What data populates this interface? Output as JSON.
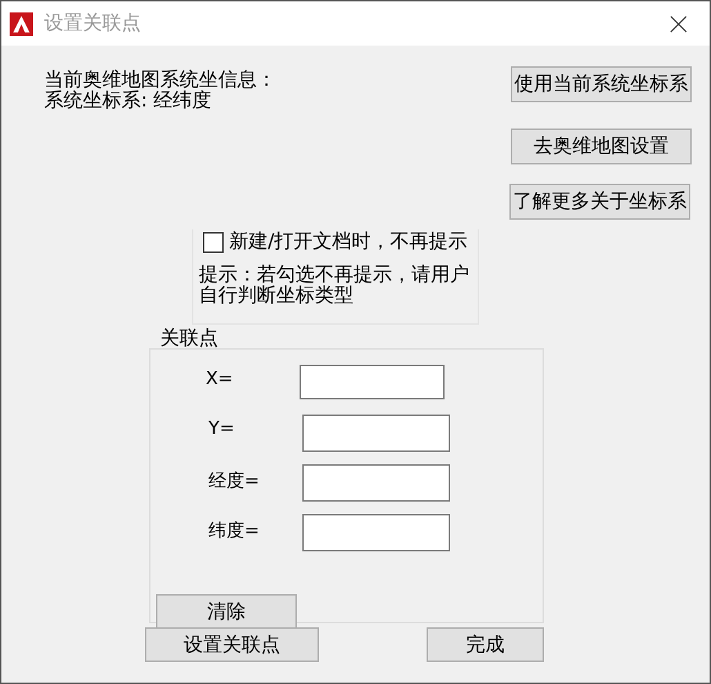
{
  "window": {
    "title": "设置关联点"
  },
  "info": [
    "当前奥维地图系统坐信息：",
    "系统坐标系: 经纬度"
  ],
  "side_buttons": [
    "使用当前系统坐标系",
    "去奥维地图设置",
    "了解更多关于坐标系"
  ],
  "option": {
    "label": "新建/打开文档时，不再提示",
    "checked": false,
    "hint": "提示：若勾选不再提示，请用户自行判断坐标类型"
  },
  "group": {
    "title": "关联点",
    "fields": [
      {
        "label": "X="
      },
      {
        "label": "Y="
      },
      {
        "label": "经度="
      },
      {
        "label": "纬度="
      }
    ],
    "clear_button": "清除"
  },
  "bottom_buttons": [
    "设置关联点",
    "完成"
  ]
}
